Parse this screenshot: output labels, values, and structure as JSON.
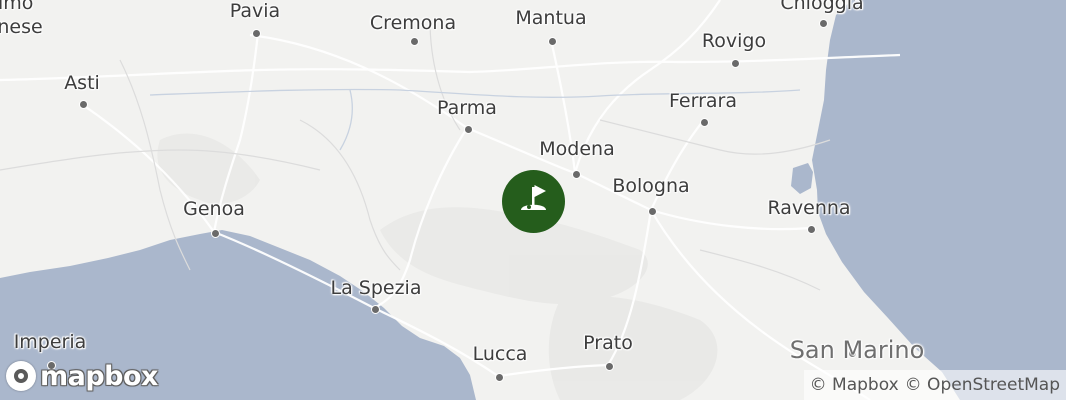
{
  "map": {
    "provider": "Mapbox",
    "colors": {
      "land": "#f2f2f0",
      "water": "#aab7cc",
      "marker": "#255d1c",
      "label": "#3d3d3d"
    },
    "marker": {
      "icon": "golf-flag-icon"
    },
    "cities": [
      {
        "id": "fragment-top",
        "label": "timo"
      },
      {
        "id": "fragment-left",
        "label": "nese"
      },
      {
        "id": "pavia",
        "label": "Pavia"
      },
      {
        "id": "cremona",
        "label": "Cremona"
      },
      {
        "id": "mantua",
        "label": "Mantua"
      },
      {
        "id": "chioggia",
        "label": "Chioggia"
      },
      {
        "id": "rovigo",
        "label": "Rovigo"
      },
      {
        "id": "asti",
        "label": "Asti"
      },
      {
        "id": "parma",
        "label": "Parma"
      },
      {
        "id": "ferrara",
        "label": "Ferrara"
      },
      {
        "id": "modena",
        "label": "Modena"
      },
      {
        "id": "bologna",
        "label": "Bologna"
      },
      {
        "id": "genoa",
        "label": "Genoa"
      },
      {
        "id": "ravenna",
        "label": "Ravenna"
      },
      {
        "id": "la-spezia",
        "label": "La Spezia"
      },
      {
        "id": "imperia",
        "label": "Imperia"
      },
      {
        "id": "lucca",
        "label": "Lucca"
      },
      {
        "id": "prato",
        "label": "Prato"
      },
      {
        "id": "san-marino",
        "label": "San Marino"
      }
    ]
  },
  "logo": {
    "text": "mapbox"
  },
  "attribution": {
    "mapbox": "© Mapbox",
    "osm": "© OpenStreetMap"
  }
}
